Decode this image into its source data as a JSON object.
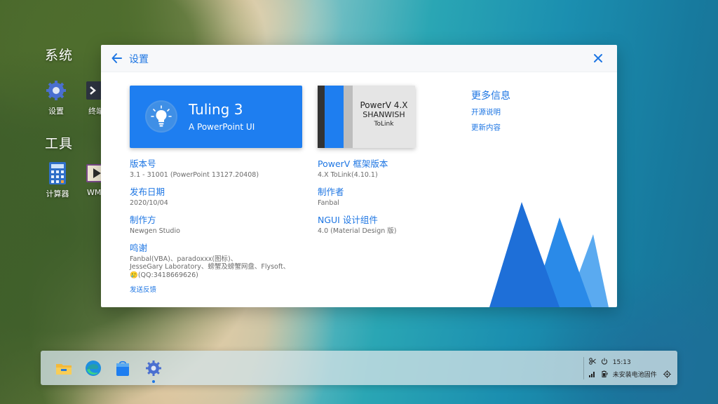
{
  "desktop": {
    "section_system": "系统",
    "section_tools": "工具",
    "icons": [
      {
        "label": "设置",
        "icon": "gear-icon"
      },
      {
        "label": "终端",
        "icon": "terminal-icon"
      },
      {
        "label": "计算器",
        "icon": "calculator-icon"
      },
      {
        "label": "WM",
        "icon": "media-player-icon"
      }
    ]
  },
  "window": {
    "title": "设置",
    "hero": {
      "title": "Tuling 3",
      "subtitle": "A PowerPoint UI",
      "icon": "lightbulb-icon"
    },
    "powerv_card": {
      "line1": "PowerV 4.X",
      "line2": "SHANWISH",
      "line3": "ToLink"
    },
    "left_info": [
      {
        "label": "版本号",
        "value": "3.1 - 31001 (PowerPoint 13127.20408)"
      },
      {
        "label": "发布日期",
        "value": "2020/10/04"
      },
      {
        "label": "制作方",
        "value": "Newgen Studio"
      },
      {
        "label": "鸣谢",
        "value_lines": [
          "Fanbal(VBA)、paradoxxx(图标)、",
          "JesseGary Laboratory、螃蟹及螃蟹网盘、Flysoft、",
          "🥲(QQ:3418669626)"
        ]
      }
    ],
    "right_info": [
      {
        "label": "PowerV 框架版本",
        "value": "4.X ToLink(4.10.1)"
      },
      {
        "label": "制作者",
        "value": "Fanbal"
      },
      {
        "label": "NGUI 设计组件",
        "value": "4.0 (Material Design 版)"
      }
    ],
    "more": {
      "title": "更多信息",
      "links": [
        "开源说明",
        "更新内容"
      ]
    },
    "feedback": "发送反馈",
    "colors": {
      "accent": "#1e76e3",
      "hero_bg": "#1e7ef0",
      "mountain_dark": "#1e6fd8",
      "mountain_mid": "#2a8ae8",
      "mountain_light": "#5aaaf0"
    }
  },
  "taskbar": {
    "apps": [
      "file-explorer-icon",
      "edge-browser-icon",
      "store-icon",
      "settings-gear-icon"
    ],
    "active_app": "settings-gear-icon",
    "time": "15:13",
    "battery_status": "未安装电池固件"
  }
}
